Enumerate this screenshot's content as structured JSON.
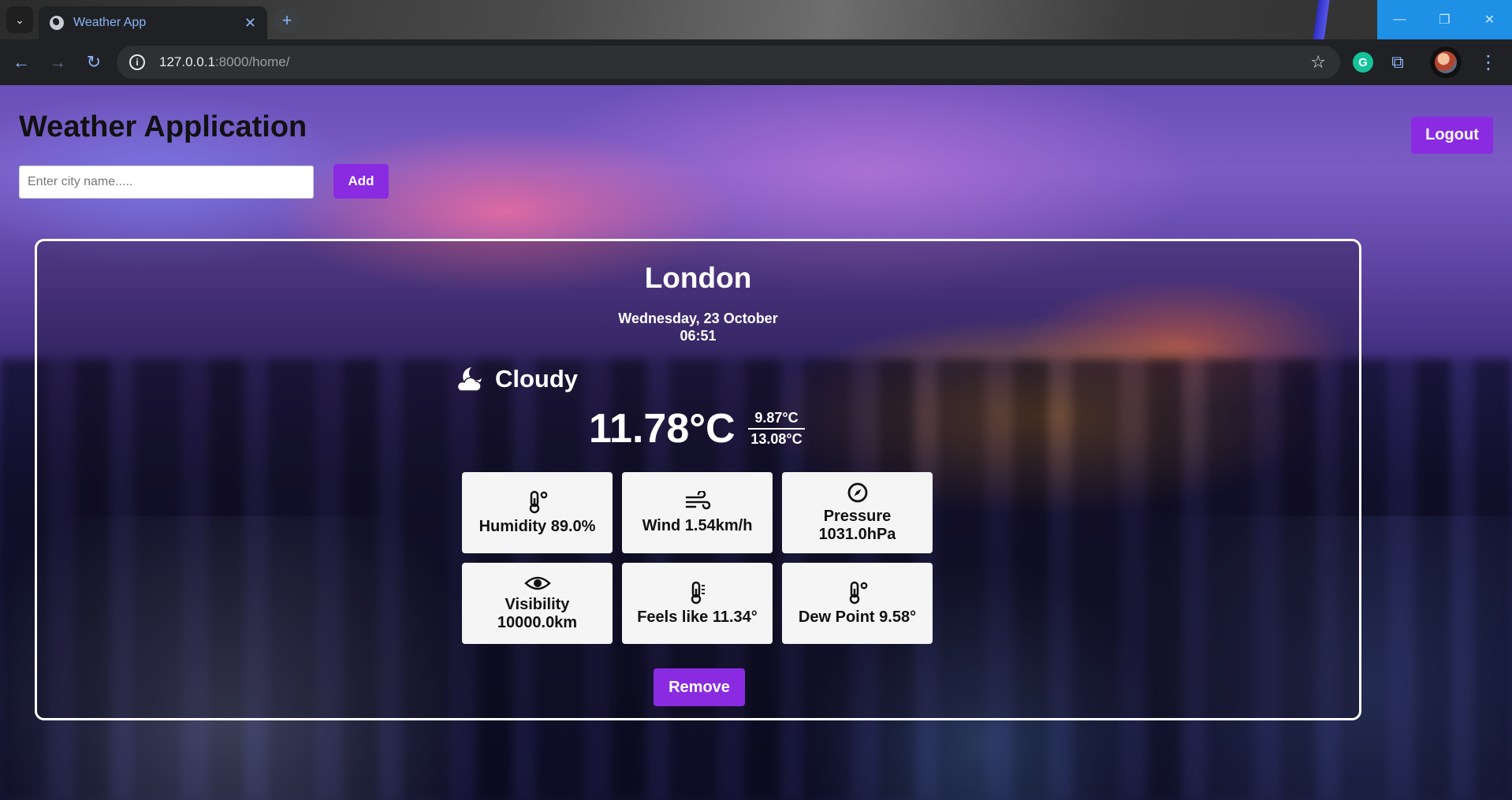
{
  "browser": {
    "tab_title": "Weather App",
    "tab_close": "✕",
    "new_tab": "+",
    "url_host": "127.0.0.1",
    "url_rest": ":8000/home/",
    "window_controls": [
      "—",
      "❐",
      "✕"
    ]
  },
  "header": {
    "title": "Weather Application",
    "logout_label": "Logout"
  },
  "search": {
    "placeholder": "Enter city name.....",
    "value": "",
    "add_label": "Add"
  },
  "weather": {
    "city": "London",
    "date": "Wednesday, 23 October",
    "time": "06:51",
    "condition": "Cloudy",
    "condition_icon": "moon-cloud-icon",
    "temperature": "11.78°C",
    "temp_min": "9.87°C",
    "temp_max": "13.08°C",
    "stats": [
      {
        "icon": "thermometer-degree-icon",
        "label": "Humidity 89.0%"
      },
      {
        "icon": "wind-icon",
        "label": "Wind 1.54km/h"
      },
      {
        "icon": "compass-icon",
        "label": "Pressure 1031.0hPa"
      },
      {
        "icon": "eye-icon",
        "label": "Visibility 10000.0km"
      },
      {
        "icon": "thermometer-icon",
        "label": "Feels like 11.34°"
      },
      {
        "icon": "thermometer-degree-icon",
        "label": "Dew Point 9.58°"
      }
    ],
    "remove_label": "Remove"
  },
  "colors": {
    "accent": "#8a2be2",
    "card_border": "#ffffff",
    "stat_bg": "#f5f5f5"
  }
}
